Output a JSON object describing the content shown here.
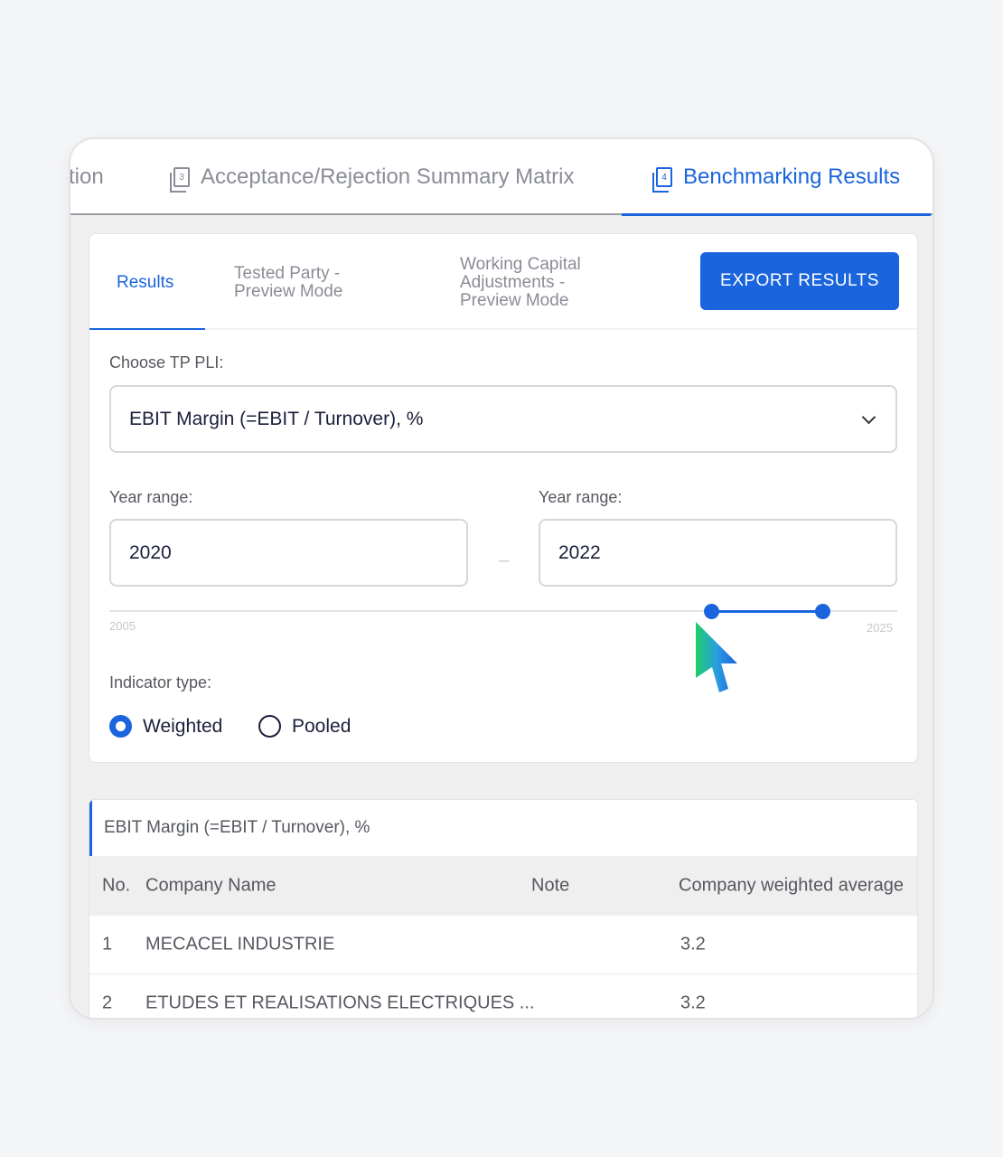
{
  "top_tabs": [
    {
      "label": "tion"
    },
    {
      "label": "Acceptance/Rejection Summary Matrix",
      "num": "3"
    },
    {
      "label": "Benchmarking Results",
      "num": "4"
    }
  ],
  "sub_tabs": [
    "Results",
    "Tested Party - Preview Mode",
    "Working Capital Adjustments - Preview Mode"
  ],
  "sub_tabs_lines": [
    [
      "Tested Party -",
      "Preview Mode"
    ],
    [
      "Working Capital",
      "Adjustments -",
      "Preview Mode"
    ]
  ],
  "export_label": "EXPORT RESULTS",
  "pli": {
    "label": "Choose TP PLI:",
    "value": "EBIT Margin (=EBIT / Turnover), %"
  },
  "year_range": {
    "from_label": "Year range:",
    "from": "2020",
    "to_label": "Year range:",
    "to": "2022",
    "separator": "–",
    "min": "2005",
    "max": "2025"
  },
  "indicator": {
    "label": "Indicator type:",
    "options": [
      "Weighted",
      "Pooled"
    ],
    "selected": "Weighted"
  },
  "table": {
    "title": "EBIT Margin (=EBIT / Turnover), %",
    "columns": [
      "No.",
      "Company Name",
      "Note",
      "Company weighted average"
    ],
    "rows": [
      {
        "no": "1",
        "name": "MECACEL INDUSTRIE",
        "note": "",
        "avg": "3.2"
      },
      {
        "no": "2",
        "name": "ETUDES ET REALISATIONS ELECTRIQUES ...",
        "note": "",
        "avg": "3.2"
      }
    ]
  },
  "colors": {
    "accent": "#1a64dd"
  }
}
